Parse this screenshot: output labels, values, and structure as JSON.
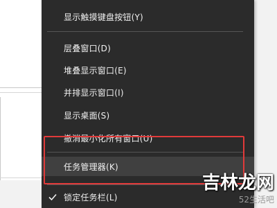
{
  "context_menu": {
    "items": [
      {
        "label": "显示触摸键盘按钮(Y)"
      },
      {
        "label": "层叠窗口(D)"
      },
      {
        "label": "堆叠显示窗口(E)"
      },
      {
        "label": "并排显示窗口(I)"
      },
      {
        "label": "显示桌面(S)"
      },
      {
        "label": "撤消最小化所有窗口(U)"
      },
      {
        "label": "任务管理器(K)",
        "highlighted": true
      },
      {
        "label": "锁定任务栏(L)",
        "checked": true
      }
    ]
  },
  "watermark": {
    "main": "吉林龙网",
    "sub": "52生活吧"
  },
  "colors": {
    "menu_bg": "#2b2b2b",
    "menu_text": "#f0f0f0",
    "highlight_bg": "#404040",
    "annotation_red": "#e23a3a"
  }
}
